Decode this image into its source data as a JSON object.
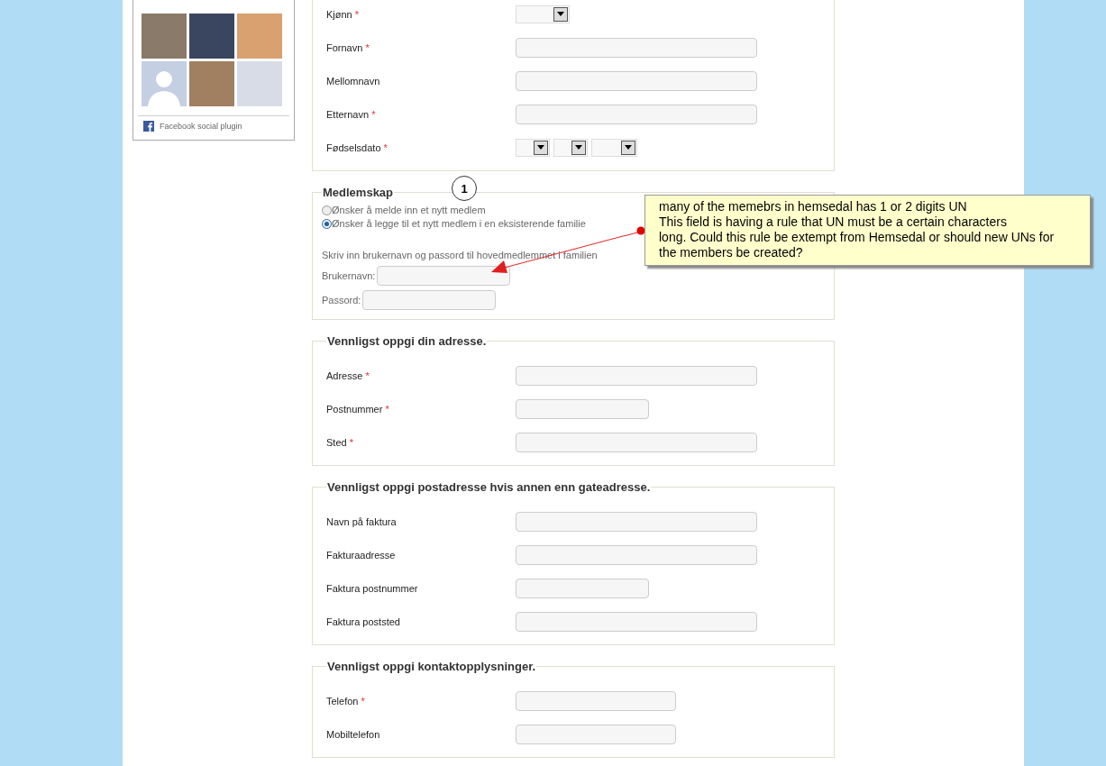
{
  "sidebar": {
    "photos": [
      {
        "kind": "photo",
        "color": "#8a7a6a"
      },
      {
        "kind": "photo",
        "color": "#3a4560"
      },
      {
        "kind": "photo",
        "color": "#d9a070"
      },
      {
        "kind": "silhouette",
        "color": "#c5cfe3"
      },
      {
        "kind": "photo",
        "color": "#a08060"
      },
      {
        "kind": "photo",
        "color": "#d8dce6"
      }
    ],
    "footer": "Facebook social plugin"
  },
  "sections": [
    {
      "kind": "fields",
      "rows": [
        {
          "label": "Kjønn",
          "marker": "*",
          "kind": "gender"
        },
        {
          "label": "Fornavn",
          "marker": "*",
          "kind": "wide"
        },
        {
          "label": "Mellomnavn",
          "kind": "wide"
        },
        {
          "label": "Etternavn",
          "marker": "*",
          "kind": "wide"
        },
        {
          "label": "Fødselsdato",
          "marker": "*",
          "kind": "date"
        }
      ]
    },
    {
      "kind": "membership",
      "title": "Medlemskap",
      "options": [
        {
          "label": "Ønsker å melde inn et nytt medlem",
          "selected": false
        },
        {
          "label": "Ønsker å legge til et nytt medlem i en eksisterende familie",
          "selected": true
        }
      ],
      "hint": "Skriv inn brukernavn og passord til hovedmedlemmet i familien",
      "credentials": [
        {
          "label": "Brukernavn:"
        },
        {
          "label": "Passord:"
        }
      ]
    },
    {
      "kind": "fields",
      "title": "Vennligst oppgi din adresse.",
      "rows": [
        {
          "label": "Adresse",
          "marker": "*",
          "kind": "wide"
        },
        {
          "label": "Postnummer",
          "marker": "*",
          "kind": "narrow"
        },
        {
          "label": "Sted",
          "marker": "*",
          "kind": "wide"
        }
      ]
    },
    {
      "kind": "fields",
      "title": "Vennligst oppgi postadresse hvis annen enn gateadresse.",
      "rows": [
        {
          "label": "Navn på faktura",
          "kind": "wide"
        },
        {
          "label": "Fakturaadresse",
          "kind": "wide"
        },
        {
          "label": "Faktura postnummer",
          "kind": "narrow"
        },
        {
          "label": "Faktura poststed",
          "kind": "wide"
        }
      ]
    },
    {
      "kind": "fields",
      "title": "Vennligst oppgi kontaktopplysninger.",
      "rows": [
        {
          "label": "Telefon",
          "marker": "*",
          "kind": "medium"
        },
        {
          "label": "Mobiltelefon",
          "kind": "medium"
        }
      ]
    }
  ],
  "annotation": {
    "number": "1",
    "note": "many of the memebrs in hemsedal has 1 or 2 digits UN\nThis field is having a rule that UN must be a certain characters\nlong. Could this rule be extempt from Hemsedal or should new UNs for\nthe members be created?"
  }
}
